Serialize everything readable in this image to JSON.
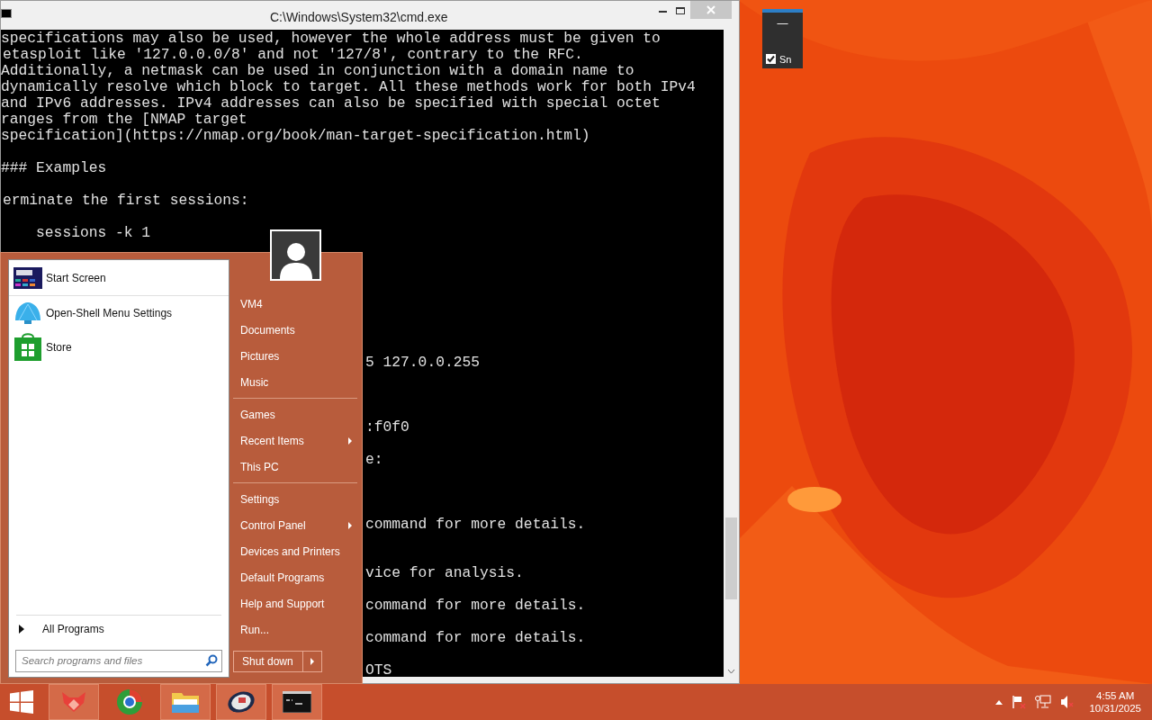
{
  "console_window": {
    "title": "C:\\Windows\\System32\\cmd.exe",
    "lines": [
      "specifications may also be used, however the whole address must be given to",
      "etasploit like '127.0.0.0/8' and not '127/8', contrary to the RFC.",
      "Additionally, a netmask can be used in conjunction with a domain name to",
      "dynamically resolve which block to target. All these methods work for both IPv4",
      "and IPv6 addresses. IPv4 addresses can also be specified with special octet",
      "ranges from the [NMAP target",
      "specification](https://nmap.org/book/man-target-specification.html)",
      "### Examples",
      "erminate the first sessions:",
      "    sessions -k 1",
      "5 127.0.0.255",
      ":f0f0",
      "e:",
      "command for more details.",
      "vice for analysis.",
      "command for more details.",
      "command for more details.",
      "OTS"
    ]
  },
  "widget": {
    "dash": "—",
    "checkbox": {
      "label": "Sn",
      "checked": true
    }
  },
  "start_menu": {
    "programs": [
      {
        "label": "Start Screen"
      },
      {
        "label": "Open-Shell Menu Settings"
      },
      {
        "label": "Store"
      }
    ],
    "all_programs": "All Programs",
    "search": {
      "placeholder": "Search programs and files"
    },
    "places": [
      {
        "label": "VM4",
        "submenu": false
      },
      {
        "label": "Documents",
        "submenu": false
      },
      {
        "label": "Pictures",
        "submenu": false
      },
      {
        "label": "Music",
        "submenu": false
      },
      {
        "label": "Games",
        "submenu": false
      },
      {
        "label": "Recent Items",
        "submenu": true
      },
      {
        "label": "This PC",
        "submenu": false
      },
      {
        "label": "Settings",
        "submenu": false
      },
      {
        "label": "Control Panel",
        "submenu": true
      },
      {
        "label": "Devices and Printers",
        "submenu": false
      },
      {
        "label": "Default Programs",
        "submenu": false
      },
      {
        "label": "Help and Support",
        "submenu": false
      },
      {
        "label": "Run...",
        "submenu": false
      }
    ],
    "shutdown": "Shut down"
  },
  "taskbar": {
    "clock": {
      "time": "4:55 AM",
      "date": "10/31/2025"
    }
  }
}
